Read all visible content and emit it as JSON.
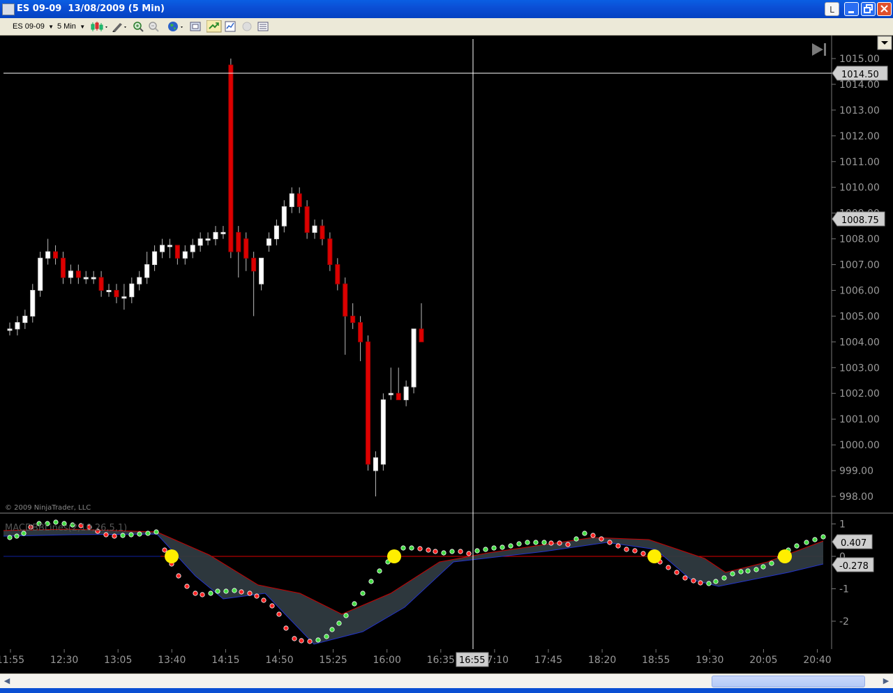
{
  "window": {
    "title": "ES 09-09  13/08/2009 (5 Min)",
    "buttons": {
      "link": "L",
      "minimize": "_",
      "maximize": "□",
      "close": "✕"
    }
  },
  "toolbar": {
    "instrument": "ES 09-09",
    "interval": "5 Min"
  },
  "chart": {
    "copyright": "© 2009 NinjaTrader, LLC",
    "indicator_label": "MACDBBLines(2,10,26,5,1)",
    "crosshair_price": "1014.50",
    "last_price": "1008.75",
    "crosshair_time": "16:55",
    "macd_value": "0.407",
    "macd_avg_value": "-0.278",
    "price_axis": [
      "1015.00",
      "1014.00",
      "1013.00",
      "1012.00",
      "1011.00",
      "1010.00",
      "1009.00",
      "1008.00",
      "1007.00",
      "1006.00",
      "1005.00",
      "1004.00",
      "1003.00",
      "1002.00",
      "1001.00",
      "1000.00",
      "999.00",
      "998.00"
    ],
    "indicator_axis": [
      "1",
      "0",
      "-1",
      "-2"
    ],
    "time_axis": [
      "11:55",
      "12:30",
      "13:05",
      "13:40",
      "14:15",
      "14:50",
      "15:25",
      "16:00",
      "16:35",
      "17:10",
      "17:45",
      "18:20",
      "18:55",
      "19:30",
      "20:05",
      "20:40"
    ],
    "colors": {
      "up": "#ffffff",
      "down": "#dd0000",
      "band_fill": "#2f3a40",
      "upper_band": "#cc0000",
      "lower_band": "#2233cc",
      "zero_line": "#1020a0",
      "ref_line": "#dd0000",
      "dot_up": "#44dd44",
      "dot_down": "#ff2222",
      "signal": "#ffee00"
    }
  },
  "chart_data": {
    "type": "candlestick",
    "ylim": [
      997.5,
      1015.5
    ],
    "candles": [
      {
        "t": "11:55",
        "o": 1004.5,
        "h": 1004.75,
        "l": 1004.25,
        "c": 1004.5
      },
      {
        "t": "12:00",
        "o": 1004.5,
        "h": 1005,
        "l": 1004.25,
        "c": 1004.75
      },
      {
        "t": "12:05",
        "o": 1004.75,
        "h": 1005.25,
        "l": 1004.5,
        "c": 1005
      },
      {
        "t": "12:10",
        "o": 1005,
        "h": 1006.25,
        "l": 1004.75,
        "c": 1006
      },
      {
        "t": "12:15",
        "o": 1006,
        "h": 1007.5,
        "l": 1005.75,
        "c": 1007.25
      },
      {
        "t": "12:20",
        "o": 1007.25,
        "h": 1008,
        "l": 1007,
        "c": 1007.5
      },
      {
        "t": "12:25",
        "o": 1007.5,
        "h": 1007.75,
        "l": 1007,
        "c": 1007.25
      },
      {
        "t": "12:30",
        "o": 1007.25,
        "h": 1007.5,
        "l": 1006.25,
        "c": 1006.5
      },
      {
        "t": "12:35",
        "o": 1006.5,
        "h": 1007,
        "l": 1006.25,
        "c": 1006.75
      },
      {
        "t": "12:40",
        "o": 1006.75,
        "h": 1007,
        "l": 1006.25,
        "c": 1006.5
      },
      {
        "t": "12:45",
        "o": 1006.5,
        "h": 1006.75,
        "l": 1006.25,
        "c": 1006.5
      },
      {
        "t": "12:50",
        "o": 1006.5,
        "h": 1006.75,
        "l": 1006.25,
        "c": 1006.5
      },
      {
        "t": "12:55",
        "o": 1006.5,
        "h": 1006.75,
        "l": 1005.75,
        "c": 1006
      },
      {
        "t": "13:00",
        "o": 1006,
        "h": 1006.25,
        "l": 1005.75,
        "c": 1006
      },
      {
        "t": "13:05",
        "o": 1006,
        "h": 1006.25,
        "l": 1005.5,
        "c": 1005.75
      },
      {
        "t": "13:10",
        "o": 1005.75,
        "h": 1006.25,
        "l": 1005.25,
        "c": 1005.75
      },
      {
        "t": "13:15",
        "o": 1005.75,
        "h": 1006.5,
        "l": 1005.5,
        "c": 1006.25
      },
      {
        "t": "13:20",
        "o": 1006.25,
        "h": 1006.75,
        "l": 1006,
        "c": 1006.5
      },
      {
        "t": "13:25",
        "o": 1006.5,
        "h": 1007.5,
        "l": 1006.25,
        "c": 1007
      },
      {
        "t": "13:30",
        "o": 1007,
        "h": 1007.75,
        "l": 1006.75,
        "c": 1007.5
      },
      {
        "t": "13:35",
        "o": 1007.5,
        "h": 1008,
        "l": 1007.25,
        "c": 1007.75
      },
      {
        "t": "13:40",
        "o": 1007.75,
        "h": 1008,
        "l": 1007.25,
        "c": 1007.75
      },
      {
        "t": "13:45",
        "o": 1007.75,
        "h": 1007.75,
        "l": 1007,
        "c": 1007.25
      },
      {
        "t": "13:50",
        "o": 1007.25,
        "h": 1007.75,
        "l": 1007,
        "c": 1007.5
      },
      {
        "t": "13:55",
        "o": 1007.5,
        "h": 1008,
        "l": 1007.25,
        "c": 1007.75
      },
      {
        "t": "14:00",
        "o": 1007.75,
        "h": 1008.25,
        "l": 1007.5,
        "c": 1008
      },
      {
        "t": "14:05",
        "o": 1008,
        "h": 1008.25,
        "l": 1007.75,
        "c": 1008
      },
      {
        "t": "14:10",
        "o": 1008,
        "h": 1008.5,
        "l": 1007.75,
        "c": 1008.25
      },
      {
        "t": "14:15",
        "o": 1008.25,
        "h": 1008.5,
        "l": 1008,
        "c": 1008.25
      },
      {
        "t": "14:20",
        "o": 1014.75,
        "h": 1015,
        "l": 1007.25,
        "c": 1007.5
      },
      {
        "t": "14:25",
        "o": 1008.25,
        "h": 1008.5,
        "l": 1006.5,
        "c": 1007.5
      },
      {
        "t": "14:30",
        "o": 1008,
        "h": 1008.25,
        "l": 1006.75,
        "c": 1007.25
      },
      {
        "t": "14:35",
        "o": 1007.25,
        "h": 1007.5,
        "l": 1005,
        "c": 1006.75
      },
      {
        "t": "14:40",
        "o": 1006.25,
        "h": 1007.25,
        "l": 1006,
        "c": 1007.25
      },
      {
        "t": "14:45",
        "o": 1007.75,
        "h": 1008.25,
        "l": 1007.5,
        "c": 1008
      },
      {
        "t": "14:50",
        "o": 1008,
        "h": 1008.75,
        "l": 1007.75,
        "c": 1008.5
      },
      {
        "t": "14:55",
        "o": 1008.5,
        "h": 1009.5,
        "l": 1008.25,
        "c": 1009.25
      },
      {
        "t": "15:00",
        "o": 1009.25,
        "h": 1010,
        "l": 1009,
        "c": 1009.75
      },
      {
        "t": "15:05",
        "o": 1009.75,
        "h": 1010,
        "l": 1009,
        "c": 1009.25
      },
      {
        "t": "15:10",
        "o": 1009.25,
        "h": 1009.5,
        "l": 1008,
        "c": 1008.25
      },
      {
        "t": "15:15",
        "o": 1008.25,
        "h": 1008.75,
        "l": 1008,
        "c": 1008.5
      },
      {
        "t": "15:20",
        "o": 1008.5,
        "h": 1008.75,
        "l": 1007.75,
        "c": 1008
      },
      {
        "t": "15:25",
        "o": 1008,
        "h": 1008.25,
        "l": 1006.75,
        "c": 1007
      },
      {
        "t": "15:30",
        "o": 1007,
        "h": 1007.25,
        "l": 1006,
        "c": 1006.25
      },
      {
        "t": "15:35",
        "o": 1006.25,
        "h": 1006.5,
        "l": 1003.5,
        "c": 1005
      },
      {
        "t": "15:40",
        "o": 1005,
        "h": 1005.5,
        "l": 1004.5,
        "c": 1004.75
      },
      {
        "t": "15:45",
        "o": 1004.75,
        "h": 1005,
        "l": 1003.25,
        "c": 1004
      },
      {
        "t": "15:50",
        "o": 1004,
        "h": 1004.25,
        "l": 999,
        "c": 999.25
      },
      {
        "t": "15:55",
        "o": 999,
        "h": 999.75,
        "l": 998,
        "c": 999.5
      },
      {
        "t": "16:00",
        "o": 999.25,
        "h": 1002,
        "l": 999,
        "c": 1001.75
      },
      {
        "t": "16:05",
        "o": 1002,
        "h": 1003,
        "l": 1001.75,
        "c": 1002
      },
      {
        "t": "16:10",
        "o": 1002,
        "h": 1003,
        "l": 1001.75,
        "c": 1001.75
      },
      {
        "t": "16:15",
        "o": 1001.75,
        "h": 1002.5,
        "l": 1001.5,
        "c": 1002.25
      },
      {
        "t": "16:20",
        "o": 1002.25,
        "h": 1004.5,
        "l": 1002,
        "c": 1004.5
      },
      {
        "t": "16:25",
        "o": 1004.5,
        "h": 1005.5,
        "l": 1004,
        "c": 1004
      }
    ]
  }
}
